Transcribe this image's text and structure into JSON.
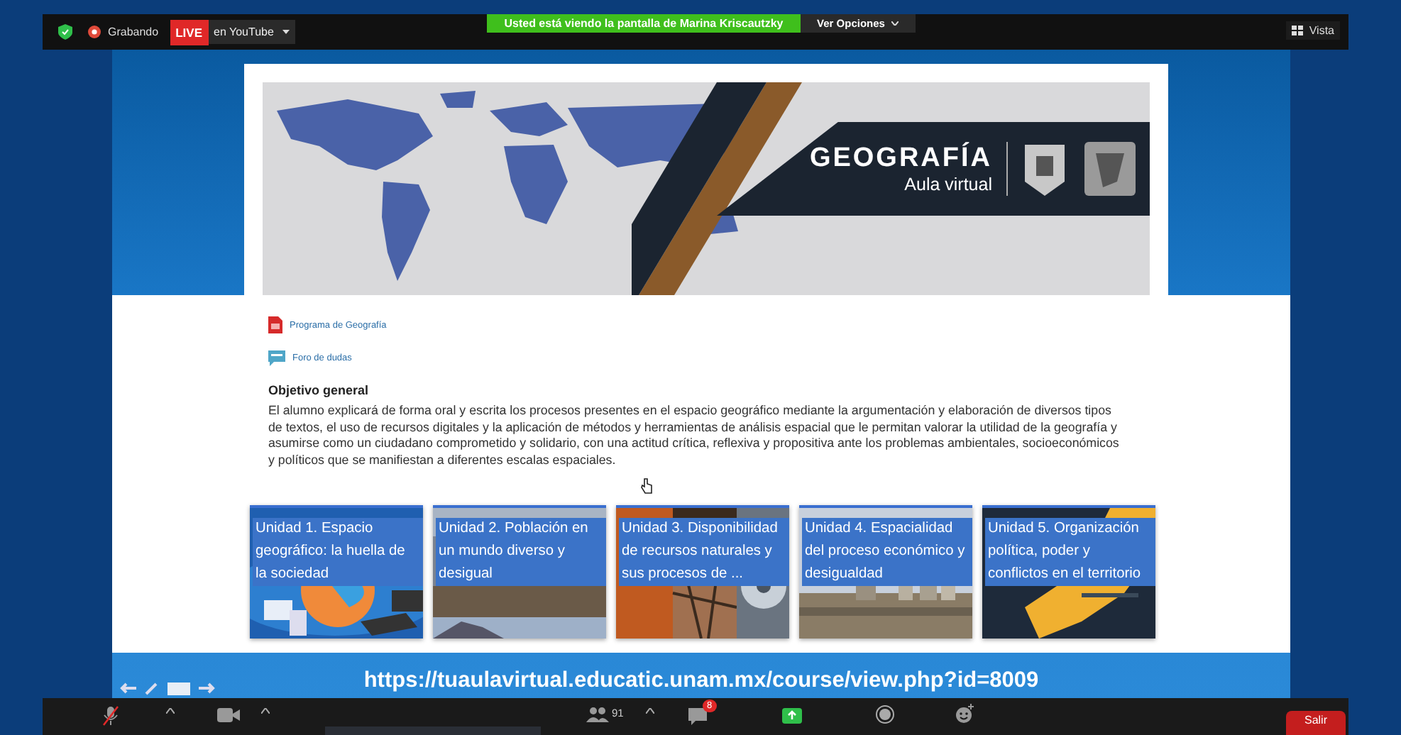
{
  "top_bar": {
    "recording_label": "Grabando",
    "live_badge": "LIVE",
    "live_destination": "en YouTube",
    "share_notice": "Usted está viendo la pantalla de Marina Kriscautzky",
    "view_options": "Ver Opciones",
    "view_button": "Vista"
  },
  "page": {
    "banner": {
      "title": "GEOGRAFÍA",
      "subtitle": "Aula virtual"
    },
    "links": [
      {
        "kind": "pdf",
        "label": "Programa de Geografía"
      },
      {
        "kind": "forum",
        "label": "Foro de dudas"
      }
    ],
    "heading": "Objetivo general",
    "paragraph": "El alumno explicará de forma oral y escrita los procesos presentes en el espacio geográfico mediante la argumentación y elaboración de diversos tipos de textos, el uso de recursos digitales y la aplicación de métodos y herramientas de análisis espacial que le permitan valorar la utilidad de la geografía y asumirse como un ciudadano comprometido y solidario, con una actitud crítica, reflexiva y propositiva ante los problemas ambientales, socioeconómicos y políticos que se manifiestan a diferentes escalas espaciales.",
    "units": [
      {
        "title": "Unidad 1. Espacio geográfico: la huella de la sociedad"
      },
      {
        "title": "Unidad 2. Población en un mundo diverso y desigual"
      },
      {
        "title": "Unidad 3. Disponibilidad de recursos naturales y sus procesos de ..."
      },
      {
        "title": "Unidad 4. Espacialidad del proceso económico y desigualdad"
      },
      {
        "title": "Unidad 5. Organización política, poder y conflictos en el territorio"
      }
    ],
    "url": "https://tuaulavirtual.educatic.unam.mx/course/view.php?id=8009"
  },
  "toolbar": {
    "mic_muted": true,
    "participants_count": "91",
    "chat_badge": "8",
    "leave_button": "Salir"
  }
}
